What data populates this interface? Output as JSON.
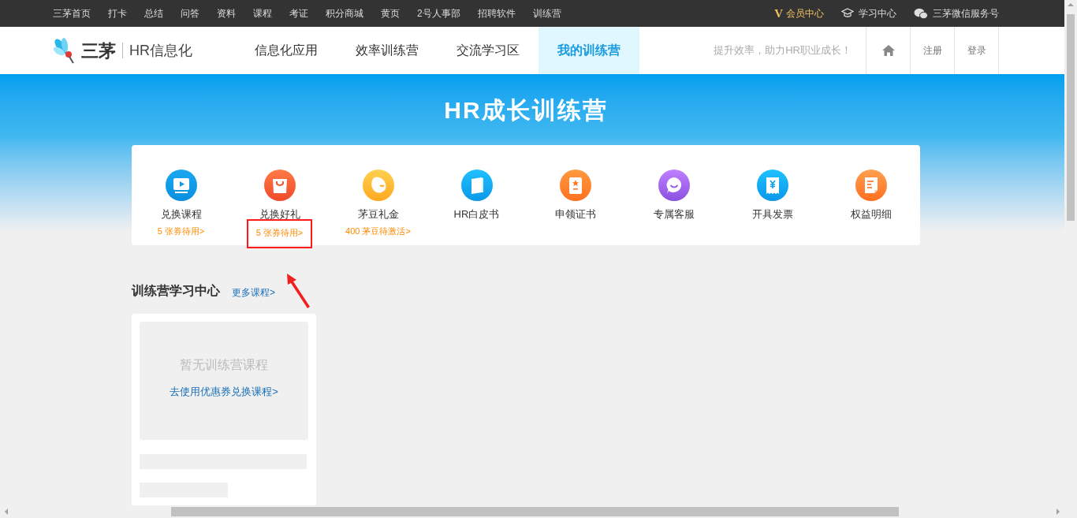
{
  "top_bar": {
    "links": [
      "三茅首页",
      "打卡",
      "总结",
      "问答",
      "资料",
      "课程",
      "考证",
      "积分商城",
      "黄页",
      "2号人事部",
      "招聘软件",
      "训练营"
    ],
    "right_links": [
      {
        "kind": "vip",
        "label": "会员中心",
        "badge": "V"
      },
      {
        "kind": "study",
        "label": "学习中心"
      },
      {
        "kind": "wechat",
        "label": "三茅微信服务号"
      }
    ]
  },
  "header": {
    "logo_text": "三茅",
    "logo_sub": "HR信息化",
    "nav": [
      {
        "label": "信息化应用",
        "selected": false
      },
      {
        "label": "效率训练营",
        "selected": false
      },
      {
        "label": "交流学习区",
        "selected": false
      },
      {
        "label": "我的训练营",
        "selected": true
      }
    ],
    "slogan": "提升效率，助力HR职业成长！",
    "actions": [
      "注册",
      "登录"
    ]
  },
  "hero": {
    "title": "HR成长训练营"
  },
  "benefits": [
    {
      "label": "兑换课程",
      "sub": "5 张券待用>",
      "highlighted": false
    },
    {
      "label": "兑换好礼",
      "sub": "5 张券待用>",
      "highlighted": true
    },
    {
      "label": "茅豆礼金",
      "sub": "400 茅豆待激活>",
      "highlighted": false
    },
    {
      "label": "HR白皮书",
      "highlighted": false
    },
    {
      "label": "申领证书",
      "highlighted": false
    },
    {
      "label": "专属客服",
      "highlighted": false
    },
    {
      "label": "开具发票",
      "highlighted": false
    },
    {
      "label": "权益明细",
      "highlighted": false
    }
  ],
  "learning": {
    "title": "训练营学习中心",
    "more": "更多课程>",
    "empty": "暂无训练营课程",
    "cta": "去使用优惠券兑换课程>"
  }
}
